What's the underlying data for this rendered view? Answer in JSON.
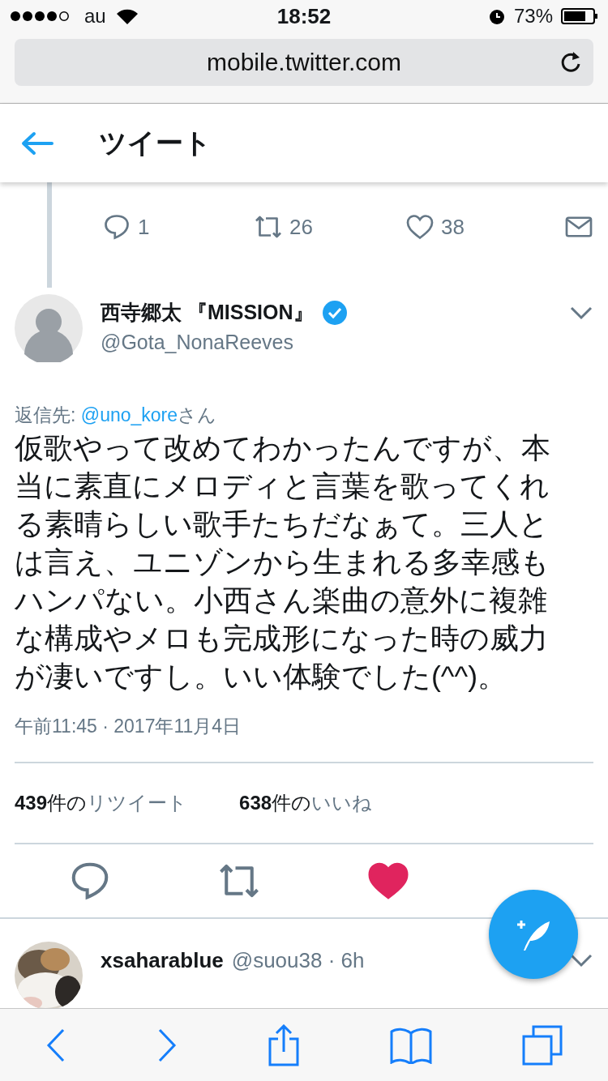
{
  "status_bar": {
    "carrier": "au",
    "time": "18:52",
    "battery": "73%"
  },
  "browser": {
    "url": "mobile.twitter.com"
  },
  "header": {
    "title": "ツイート"
  },
  "previous_tweet": {
    "actions": [
      {
        "kind": "reply",
        "count": "1"
      },
      {
        "kind": "retweet",
        "count": "26"
      },
      {
        "kind": "like",
        "count": "38"
      },
      {
        "kind": "message"
      }
    ]
  },
  "tweet": {
    "name": "西寺郷太 『MISSION』",
    "verified": true,
    "handle": "@Gota_NonaReeves",
    "reply_prefix": "返信先: ",
    "reply_to": "@uno_kore",
    "reply_suffix": "さん",
    "text": "仮歌やって改めてわかったんですが、本当に素直にメロディと言葉を歌ってくれる素晴らしい歌手たちだなぁて。三人とは言え、ユニゾンから生まれる多幸感もハンパない。小西さん楽曲の意外に複雑な構成やメロも完成形になった時の威力が凄いですし。いい体験でした(^^)。",
    "timestamp": "午前11:45 · 2017年11月4日",
    "stats": [
      {
        "count": "439",
        "unit": "件の",
        "label": "リツイート"
      },
      {
        "count": "638",
        "unit": "件の",
        "label": "いいね"
      }
    ],
    "actions": [
      {
        "kind": "reply",
        "active": false
      },
      {
        "kind": "retweet",
        "active": false
      },
      {
        "kind": "like",
        "active": true
      }
    ]
  },
  "next_tweet": {
    "name": "xsaharablue",
    "handle": "@suou38",
    "time": "· 6h"
  }
}
